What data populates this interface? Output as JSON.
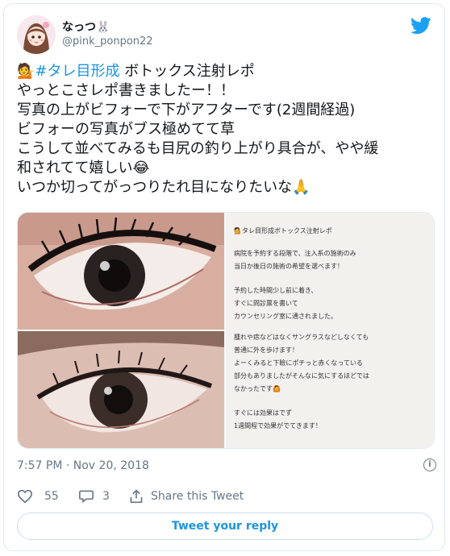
{
  "author": {
    "display_name": "なっつ🐰",
    "handle": "@pink_ponpon22",
    "avatar_icon": "avatar-illustration"
  },
  "tweet": {
    "emoji_prefix": "💁",
    "hashtag": "#タレ目形成",
    "line1_rest": " ボトックス注射レポ",
    "line2": "やっとこさレポ書きましたー！！",
    "line3": "写真の上がビフォーで下がアフターです(2週間経過)",
    "line4": "ビフォーの写真がブス極めてて草",
    "line5": "こうして並べてみるも目尻の釣り上がり具合が、やや緩",
    "line6": "和されてて嬉しい😂",
    "line7": "いつか切ってがっつりたれ目になりたいな🙏"
  },
  "media": {
    "note_lines": [
      "💁タレ目形成ボトックス注射レポ",
      "",
      "病院を予約する段階で、注入系の施術のみ",
      "当日か後日の施術の希望を選べます！",
      "",
      "予約した時間少し前に着き、",
      "すぐに問診票を書いて",
      "カウンセリング室に通されました。",
      "腫れや痣などはなくサングラスなどしなくても",
      "普通に外を歩けます！",
      "よーくみると下瞼にポチっと赤くなっている",
      "部分もありましたがそんなに気にするほどでは",
      "なかったです🙆",
      "",
      "すぐには効果はでず",
      "1週間程で効果がでてきます！"
    ]
  },
  "meta": {
    "timestamp": "7:57 PM · Nov 20, 2018",
    "info_icon": "info-icon"
  },
  "actions": {
    "like_count": "55",
    "reply_count": "3",
    "share_label": "Share this Tweet"
  },
  "reply_button": "Tweet your reply",
  "colors": {
    "accent": "#1b95e0",
    "muted": "#657786",
    "border": "#e1e8ed"
  }
}
